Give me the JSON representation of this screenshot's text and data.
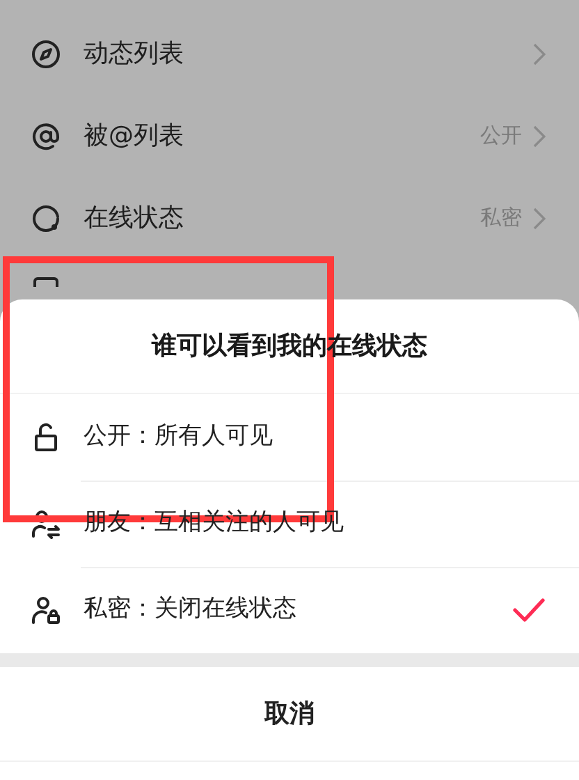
{
  "settings_list": [
    {
      "label": "动态列表"
    },
    {
      "label": "被@列表",
      "value": "公开"
    },
    {
      "label": "在线状态",
      "value": "私密"
    }
  ],
  "sheet": {
    "title": "谁可以看到我的在线状态",
    "options": [
      {
        "label": "公开：所有人可见",
        "selected": false
      },
      {
        "label": "朋友：互相关注的人可见",
        "selected": false
      },
      {
        "label": "私密：关闭在线状态",
        "selected": true
      }
    ],
    "cancel": "取消"
  }
}
